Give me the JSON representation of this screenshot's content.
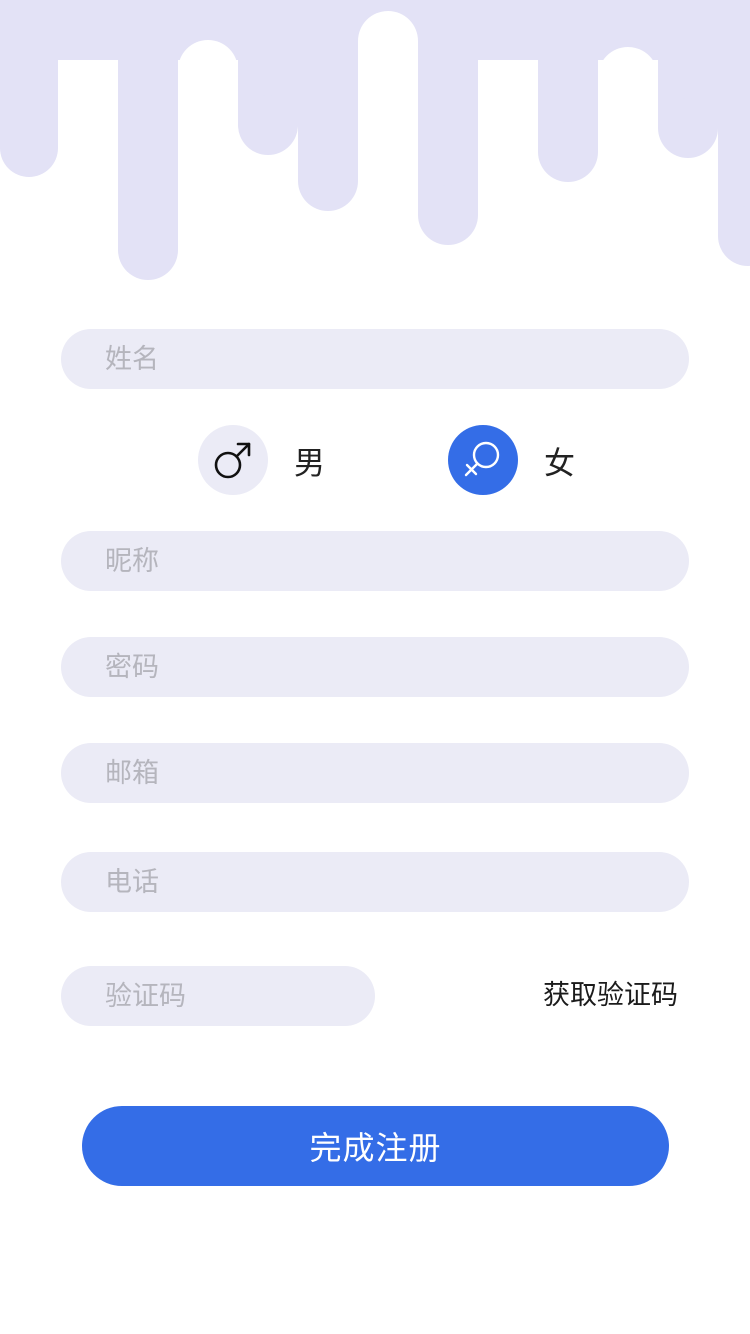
{
  "theme": {
    "accent": "#346de7",
    "field_background": "#ebebf6",
    "header_drip": "#e3e2f6",
    "placeholder": "#b5b5bd"
  },
  "form": {
    "name_placeholder": "姓名",
    "nickname_placeholder": "昵称",
    "password_placeholder": "密码",
    "email_placeholder": "邮箱",
    "phone_placeholder": "电话",
    "code_placeholder": "验证码"
  },
  "gender": {
    "male": {
      "label": "男",
      "icon": "male-symbol-icon",
      "selected": false
    },
    "female": {
      "label": "女",
      "icon": "female-symbol-icon",
      "selected": true
    }
  },
  "get_code_label": "获取验证码",
  "submit_label": "完成注册"
}
